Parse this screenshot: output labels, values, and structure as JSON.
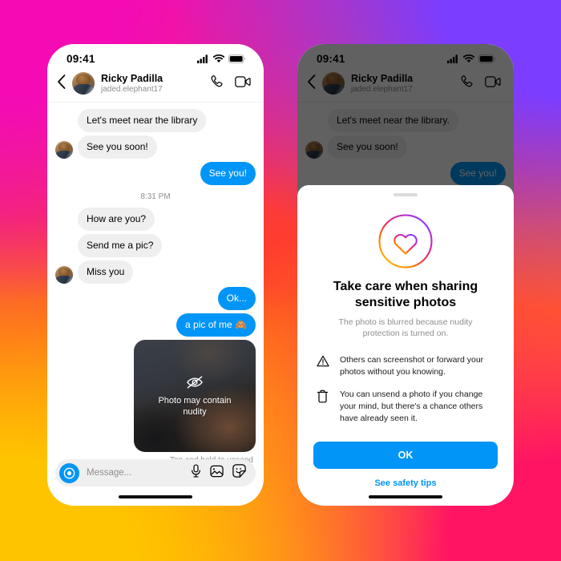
{
  "background": {
    "colors": [
      "#f40bb4",
      "#7b3dff",
      "#ff3d2e",
      "#ff7a18",
      "#ffc400",
      "#ff1464"
    ]
  },
  "accent": {
    "blue": "#0095f6",
    "bubble_gray": "#efefef",
    "muted": "#8e8e8e"
  },
  "status_bar": {
    "time": "09:41",
    "icons": [
      "cellular-signal-icon",
      "wifi-icon",
      "battery-icon"
    ]
  },
  "chat_header": {
    "back_icon": "chevron-left-icon",
    "avatar": "contact-avatar",
    "name": "Ricky Padilla",
    "handle": "jaded.elephant17",
    "call_icon": "phone-call-icon",
    "video_icon": "video-camera-icon"
  },
  "left_phone": {
    "messages": [
      {
        "id": "m1",
        "text": "Let's meet near the library",
        "side": "in",
        "avatar": false
      },
      {
        "id": "m2",
        "text": "See you soon!",
        "side": "in",
        "avatar": true
      },
      {
        "id": "m3",
        "text": "See you!",
        "side": "out"
      }
    ],
    "timestamp": "8:31 PM",
    "messages2": [
      {
        "id": "m4",
        "text": "How are you?",
        "side": "in",
        "avatar": false
      },
      {
        "id": "m5",
        "text": "Send me a pic?",
        "side": "in",
        "avatar": false
      },
      {
        "id": "m6",
        "text": "Miss you",
        "side": "in",
        "avatar": true
      },
      {
        "id": "m7",
        "text": "Ok...",
        "side": "out"
      },
      {
        "id": "m8",
        "text": "a pic of me 🙈",
        "side": "out"
      }
    ],
    "photo": {
      "icon": "eye-slash-icon",
      "caption": "Photo may contain nudity",
      "unsend_hint": "Tap and hold to unsend"
    },
    "composer": {
      "camera_icon": "camera-circle-icon",
      "placeholder": "Message...",
      "value": "",
      "icons": [
        "microphone-icon",
        "photo-gallery-icon",
        "sticker-icon"
      ]
    }
  },
  "right_phone": {
    "messages": [
      {
        "id": "r1",
        "text": "Let's meet near the library.",
        "side": "in",
        "avatar": false
      },
      {
        "id": "r2",
        "text": "See you soon!",
        "side": "in",
        "avatar": true
      },
      {
        "id": "r3",
        "text": "See you!",
        "side": "out"
      }
    ],
    "sheet": {
      "grabber": "drag-handle",
      "logo_icon": "heart-in-circle-gradient-icon",
      "title": "Take care when sharing sensitive photos",
      "subtitle": "The photo is blurred because nudity protection is turned on.",
      "bullets": [
        {
          "icon": "warning-triangle-icon",
          "text": "Others can screenshot or forward your photos without you knowing."
        },
        {
          "icon": "trash-can-icon",
          "text": "You can unsend a photo if you change your mind, but there's a chance others have already seen it."
        }
      ],
      "primary_button": "OK",
      "link": "See safety tips"
    }
  }
}
